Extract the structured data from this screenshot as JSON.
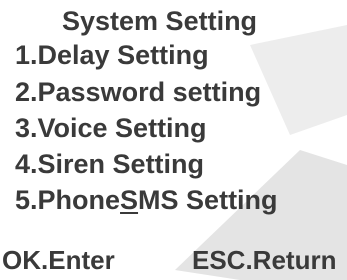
{
  "screen": {
    "title": "System Setting"
  },
  "menu": {
    "items": [
      {
        "label": "1.Delay Setting"
      },
      {
        "label": "2.Password setting"
      },
      {
        "label": "3.Voice Setting"
      },
      {
        "label": "4.Siren Setting"
      },
      {
        "label_prefix": "5.Phone",
        "label_hotkey": "S",
        "label_suffix": "MS Setting"
      }
    ]
  },
  "footer": {
    "ok_label": "OK.Enter",
    "esc_label": "ESC.Return"
  },
  "colors": {
    "text": "#3a3a3a",
    "background": "#ffffff",
    "watermark": "#e6e6e6"
  }
}
